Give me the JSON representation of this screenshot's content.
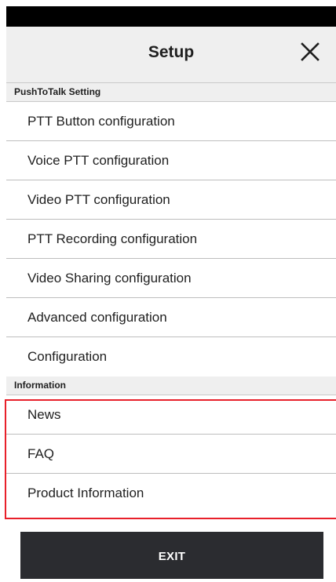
{
  "header": {
    "title": "Setup",
    "close_icon": "close-icon"
  },
  "sections": [
    {
      "label": "PushToTalk Setting",
      "items": [
        "PTT Button configuration",
        "Voice PTT configuration",
        "Video PTT configuration",
        "PTT Recording configuration",
        "Video Sharing configuration",
        "Advanced configuration",
        "Configuration"
      ]
    },
    {
      "label": "Information",
      "items": [
        "News",
        "FAQ",
        "Product Information"
      ]
    }
  ],
  "exit_button": {
    "label": "EXIT"
  },
  "colors": {
    "status_bar": "#000000",
    "header_bg": "#efefef",
    "highlight": "#e8202a",
    "exit_bg": "#2b2c30"
  }
}
